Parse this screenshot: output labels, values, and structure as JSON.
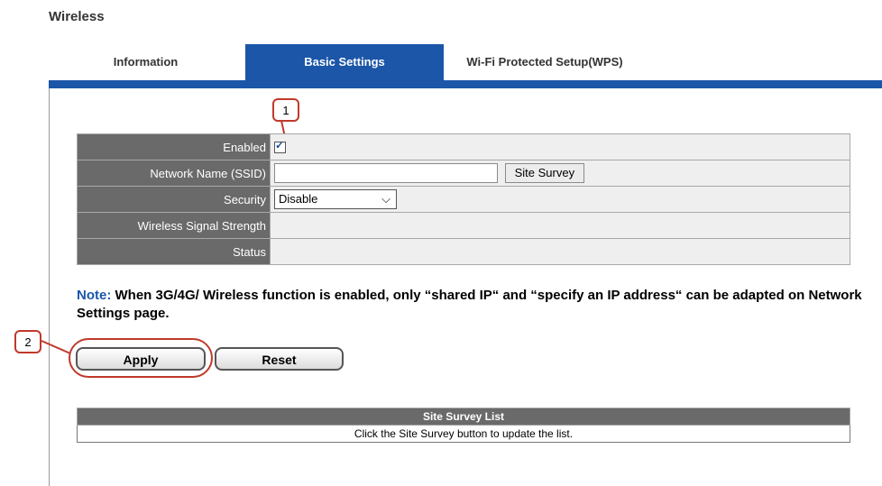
{
  "page": {
    "title": "Wireless"
  },
  "tabs": [
    {
      "label": "Information"
    },
    {
      "label": "Basic Settings"
    },
    {
      "label": "Wi-Fi Protected Setup(WPS)"
    }
  ],
  "form": {
    "enabled": {
      "label": "Enabled",
      "checked": true
    },
    "ssid": {
      "label": "Network Name (SSID)",
      "value": "",
      "button": "Site Survey"
    },
    "security": {
      "label": "Security",
      "value": "Disable"
    },
    "signal": {
      "label": "Wireless Signal Strength",
      "value": ""
    },
    "status": {
      "label": "Status",
      "value": ""
    }
  },
  "note": {
    "label": "Note:",
    "text": " When 3G/4G/ Wireless function is enabled, only “shared IP“ and “specify an IP address“ can be adapted on Network Settings page."
  },
  "buttons": {
    "apply": "Apply",
    "reset": "Reset"
  },
  "callouts": {
    "one": "1",
    "two": "2"
  },
  "site_survey": {
    "header": "Site Survey List",
    "message": "Click the Site Survey button to update the list."
  },
  "colors": {
    "accent": "#1b56a8",
    "callout": "#c0392b",
    "label_bg": "#6a6a6a"
  }
}
